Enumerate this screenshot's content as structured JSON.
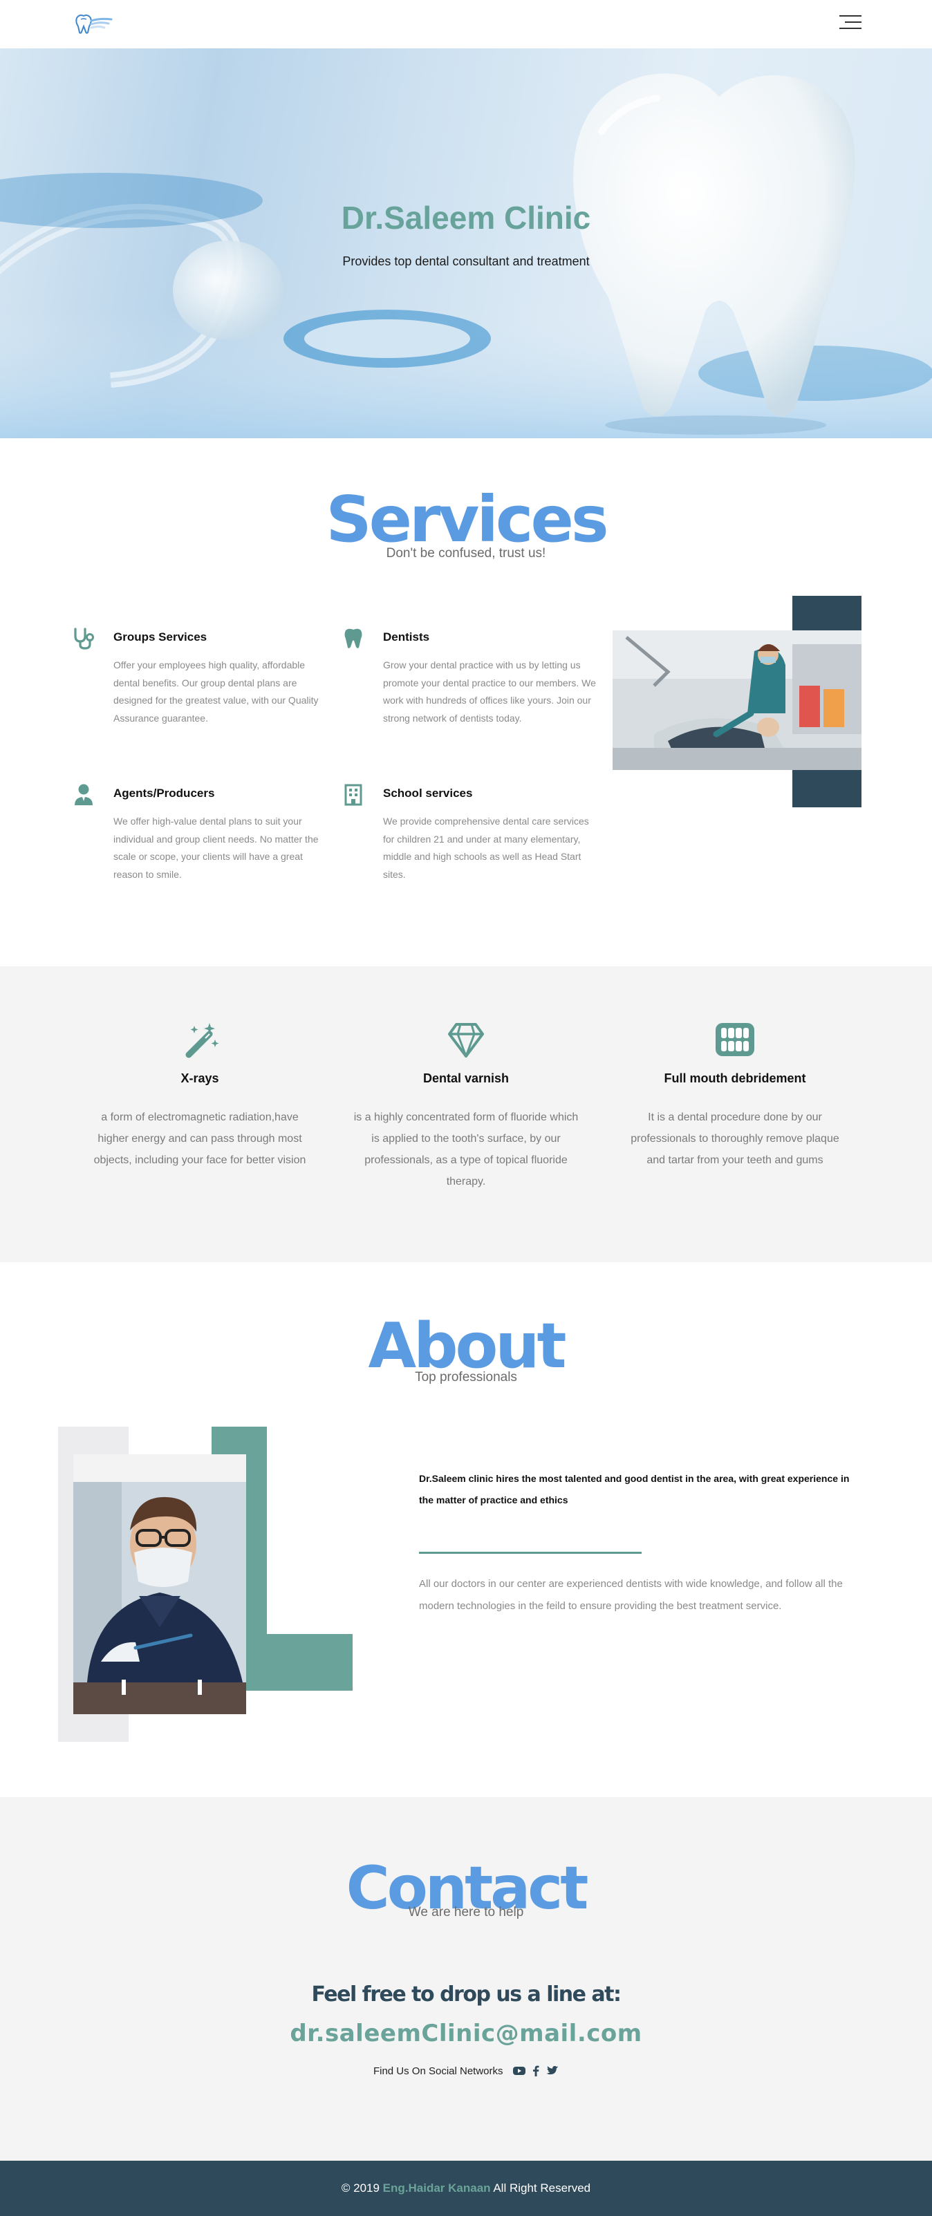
{
  "nav": {
    "logo_icon": "tooth-logo-icon",
    "menu_icon": "hamburger-menu-icon"
  },
  "hero": {
    "title": "Dr.Saleem Clinic",
    "subtitle": "Provides top dental consultant and treatment"
  },
  "services": {
    "heading": "Services",
    "subheading": "Don't be confused, trust us!",
    "items": [
      {
        "icon": "stethoscope-icon",
        "title": "Groups Services",
        "desc": "Offer your employees high quality, affordable dental benefits. Our group dental plans are designed for the greatest value, with our Quality Assurance guarantee."
      },
      {
        "icon": "tooth-icon",
        "title": "Dentists",
        "desc": "Grow your dental practice with us by letting us promote your dental practice to our members. We work with hundreds of offices like yours. Join our strong network of dentists today."
      },
      {
        "icon": "user-tie-icon",
        "title": "Agents/Producers",
        "desc": "We offer high-value dental plans to suit your individual and group client needs. No matter the scale or scope, your clients will have a great reason to smile."
      },
      {
        "icon": "school-building-icon",
        "title": "School services",
        "desc": "We provide comprehensive dental care services for children 21 and under at many elementary, middle and high schools as well as Head Start sites."
      }
    ]
  },
  "features": [
    {
      "icon": "magic-wand-icon",
      "title": "X-rays",
      "desc": "a form of electromagnetic radiation,have higher energy and can pass through most objects, including your face for better vision"
    },
    {
      "icon": "diamond-icon",
      "title": "Dental varnish",
      "desc": "is a highly concentrated form of fluoride which is applied to the tooth's surface, by our professionals, as a type of topical fluoride therapy."
    },
    {
      "icon": "teeth-icon",
      "title": "Full mouth debridement",
      "desc": "It is a dental procedure done by our professionals to thoroughly remove plaque and tartar from your teeth and gums"
    }
  ],
  "about": {
    "heading": "About",
    "subheading": "Top professionals",
    "lead": "Dr.Saleem clinic hires the most talented and good dentist in the area, with great experience in the matter of practice and ethics",
    "body": "All our doctors in our center are experienced dentists with wide knowledge, and follow all the modern technologies in the feild to ensure providing the best treatment service."
  },
  "contact": {
    "heading": "Contact",
    "subheading": "We are here to help",
    "line": "Feel free to drop us a line at:",
    "email": "dr.saleemClinic@mail.com",
    "social_label": "Find Us On Social Networks",
    "social_icons": [
      "youtube-icon",
      "facebook-icon",
      "twitter-icon"
    ]
  },
  "footer": {
    "prefix": "© 2019",
    "name": "Eng.Haidar Kanaan",
    "suffix": "All Right Reserved"
  },
  "colors": {
    "brand_blue": "#5b9be1",
    "teal": "#6aa399",
    "navy": "#2f4a5b",
    "light_gray": "#f4f4f4"
  }
}
